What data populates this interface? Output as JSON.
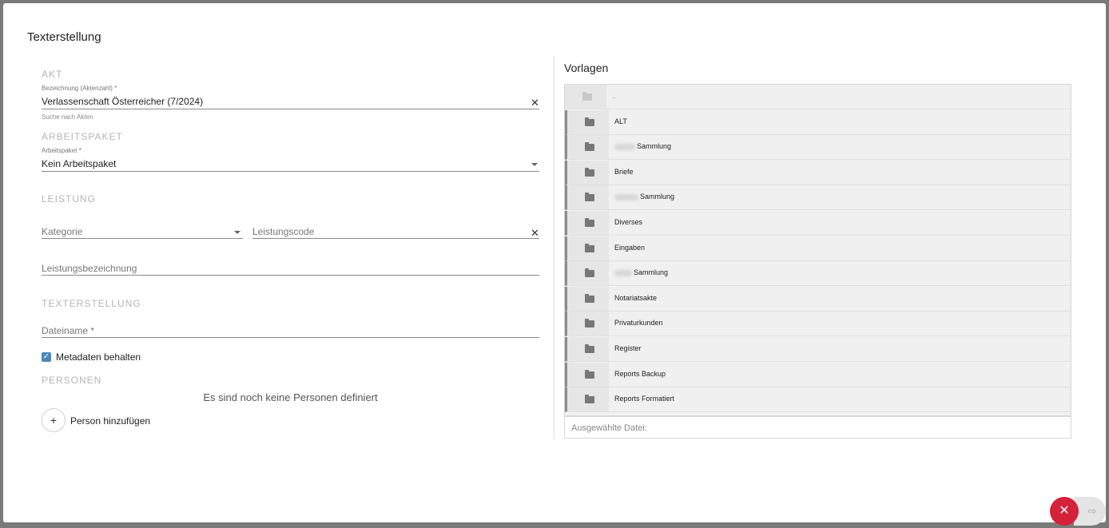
{
  "dialog": {
    "title": "Texterstellung"
  },
  "akt": {
    "section_label": "AKT",
    "field_label": "Bezeichnung (Aktenzahl) *",
    "value": "Verlassenschaft Österreicher (7/2024)",
    "hint": "Suche nach Akten",
    "clear_symbol": "✕"
  },
  "arbeitspaket": {
    "section_label": "ARBEITSPAKET",
    "field_label": "Arbeitspaket *",
    "value": "Kein Arbeitspaket"
  },
  "leistung": {
    "section_label": "LEISTUNG",
    "kategorie_placeholder": "Kategorie",
    "leistungscode_placeholder": "Leistungscode",
    "clear_symbol": "✕",
    "bezeichnung_placeholder": "Leistungsbezeichnung"
  },
  "texterstellung": {
    "section_label": "TEXTERSTELLUNG",
    "dateiname_placeholder": "Dateiname *",
    "checkbox_label": "Metadaten behalten",
    "checkbox_checked": true,
    "check_symbol": "✓"
  },
  "personen": {
    "section_label": "PERSONEN",
    "empty_message": "Es sind noch keine Personen definiert",
    "add_symbol": "+",
    "add_label": "Person hinzufügen"
  },
  "vorlagen": {
    "title": "Vorlagen",
    "items": [
      {
        "name": "..",
        "icon": "folder-up-icon"
      },
      {
        "name": "ALT",
        "icon": "folder-icon"
      },
      {
        "name": "Sammlung",
        "icon": "folder-icon",
        "redacted_prefix": true
      },
      {
        "name": "Briefe",
        "icon": "folder-icon"
      },
      {
        "name": "Sammlung",
        "icon": "folder-icon",
        "redacted_prefix": true
      },
      {
        "name": "Diverses",
        "icon": "folder-icon"
      },
      {
        "name": "Eingaben",
        "icon": "folder-icon"
      },
      {
        "name": "Sammlung",
        "icon": "folder-icon",
        "redacted_prefix": true
      },
      {
        "name": "Notariatsakte",
        "icon": "folder-icon"
      },
      {
        "name": "Privaturkunden",
        "icon": "folder-icon"
      },
      {
        "name": "Register",
        "icon": "folder-icon"
      },
      {
        "name": "Reports Backup",
        "icon": "folder-icon"
      },
      {
        "name": "Reports Formatiert",
        "icon": "folder-icon"
      }
    ],
    "selected_file_label": "Ausgewählte Datei:"
  },
  "actions": {
    "close_symbol": "✕",
    "export_symbol": "⇨"
  },
  "colors": {
    "close_button": "#d3223a",
    "checkbox": "#4f86b8"
  }
}
